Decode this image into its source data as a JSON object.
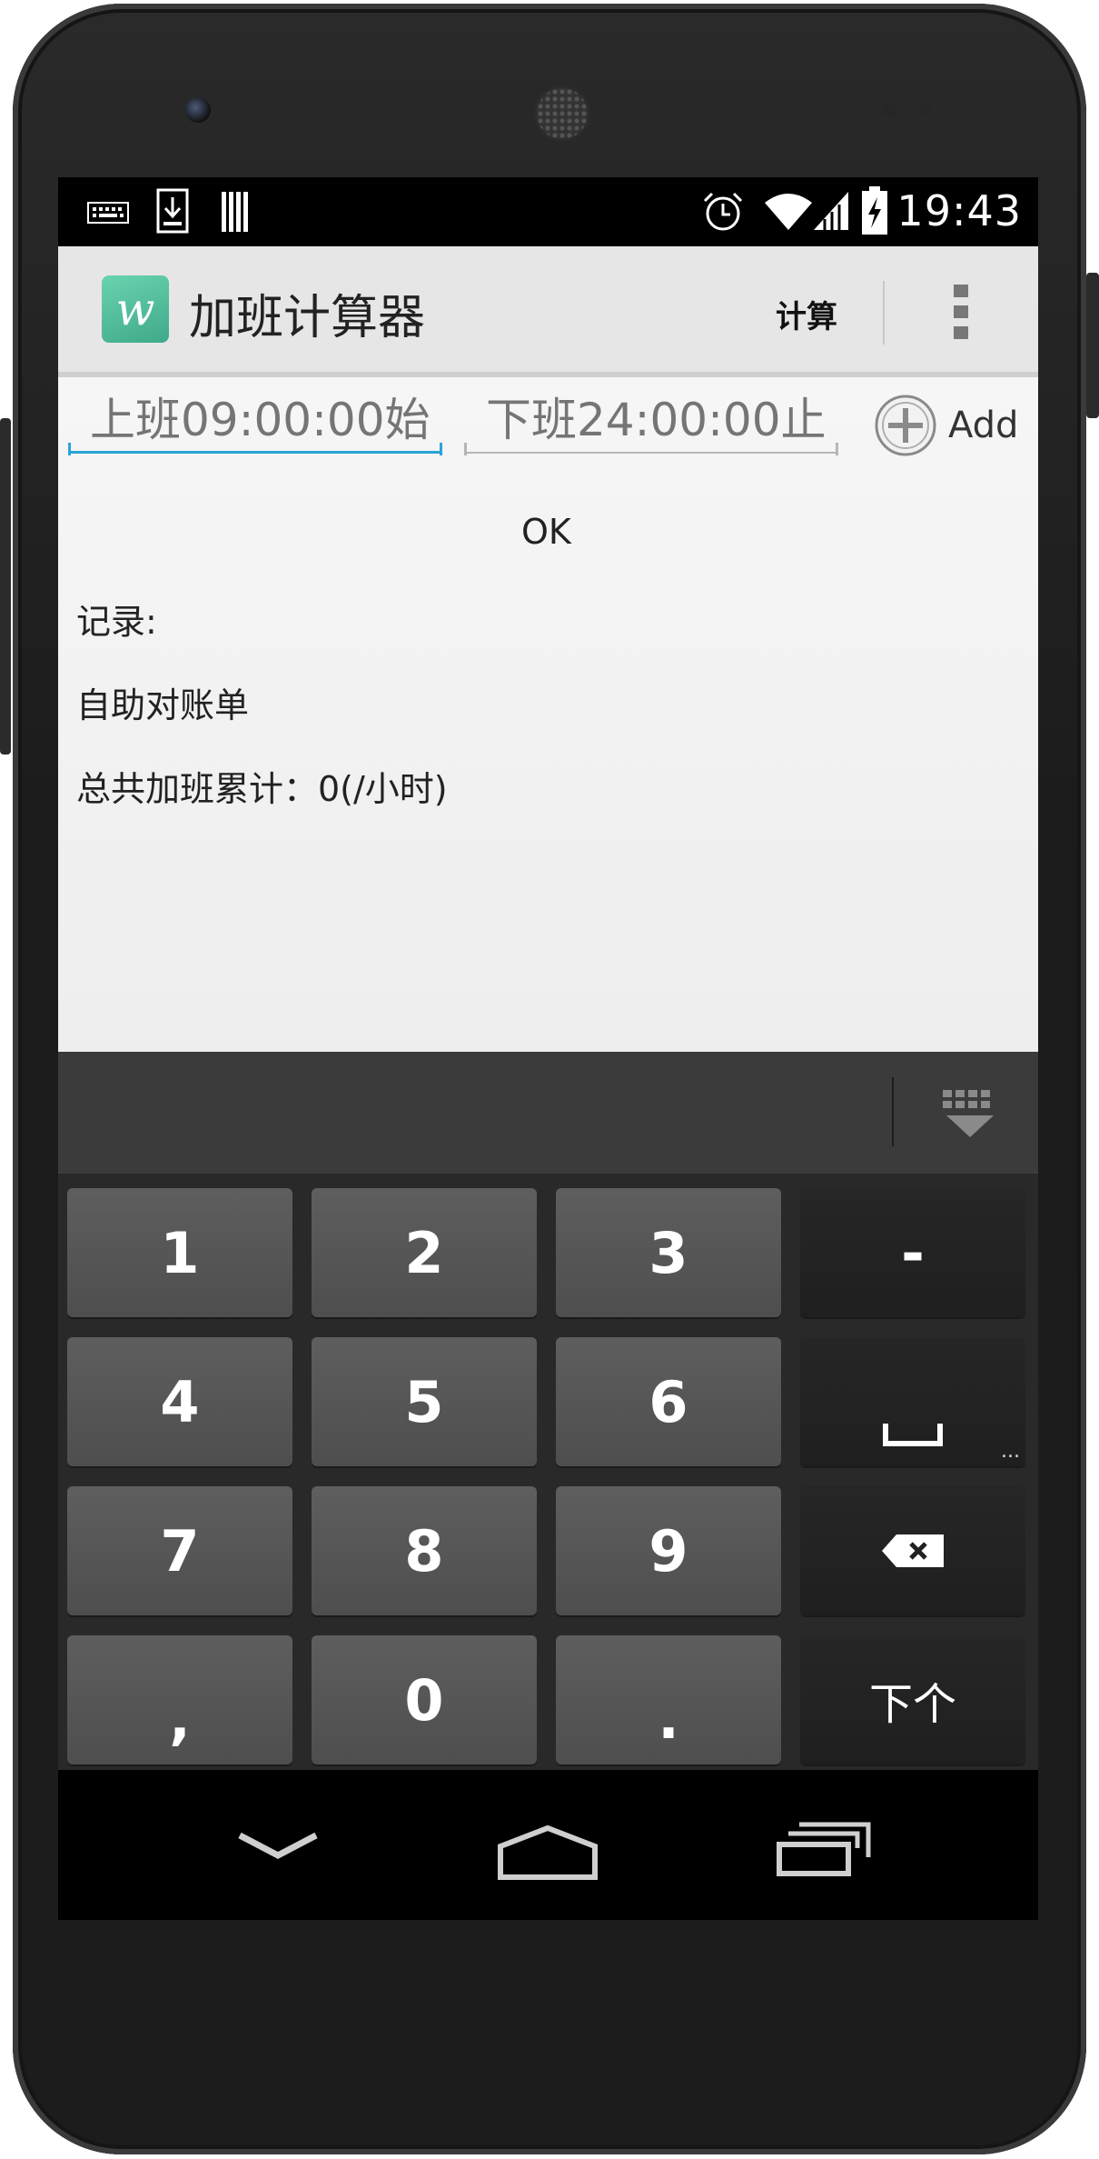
{
  "status_bar": {
    "time": "19:43",
    "icons": [
      "keyboard-icon",
      "download-icon",
      "sim-bars-icon",
      "alarm-icon",
      "wifi-icon",
      "signal-icon",
      "battery-charging-icon"
    ]
  },
  "action_bar": {
    "title": "加班计算器",
    "app_icon_letter": "w",
    "calculate_label": "计算",
    "overflow_icon": "more-vert-icon"
  },
  "form": {
    "start_placeholder": "上班09:00:00始",
    "end_placeholder": "下班24:00:00止",
    "add_label": "Add",
    "ok_label": "OK"
  },
  "content": {
    "records_label": "记录:",
    "statement_label": "自助对账单",
    "total_label": "总共加班累计：0(/小时)"
  },
  "keyboard": {
    "rows": [
      [
        "1",
        "2",
        "3",
        "-"
      ],
      [
        "4",
        "5",
        "6",
        "␣"
      ],
      [
        "7",
        "8",
        "9",
        "⌫"
      ],
      [
        ",",
        "0",
        ".",
        "下个"
      ]
    ],
    "space_more": "...",
    "next_label": "下个"
  },
  "nav_bar": {
    "icons": [
      "back-icon",
      "home-icon",
      "recent-apps-icon"
    ]
  },
  "colors": {
    "accent": "#2aa3d6",
    "action_bar": "#e6e6e6",
    "key": "#565656",
    "key_dark": "#232323"
  }
}
